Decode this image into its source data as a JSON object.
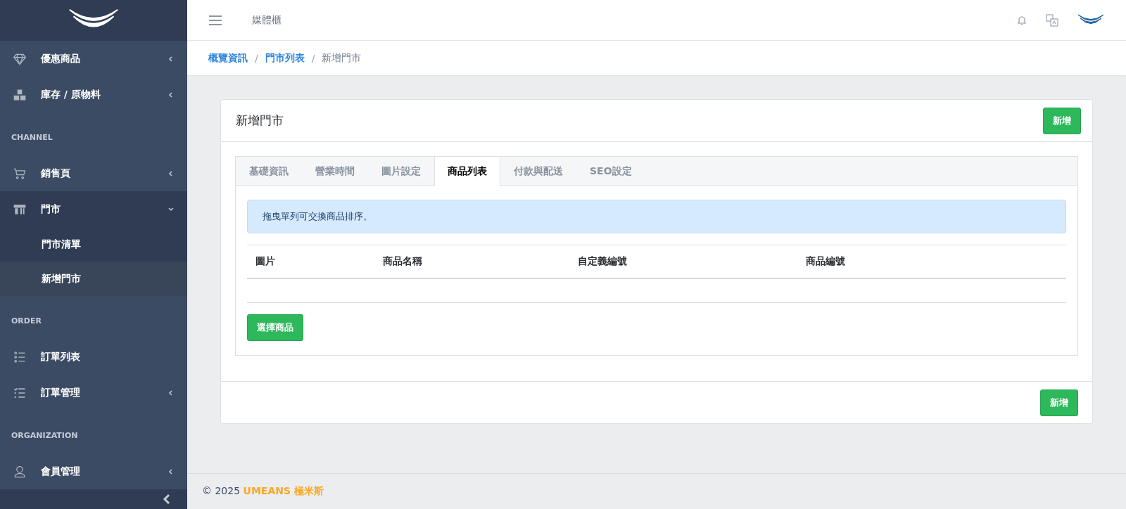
{
  "sidebar": {
    "items": [
      {
        "kind": "item",
        "label": "優惠商品",
        "expanded": false,
        "active": false
      },
      {
        "kind": "item",
        "label": "庫存 / 原物料",
        "expanded": false,
        "active": false
      },
      {
        "kind": "section",
        "label": "CHANNEL"
      },
      {
        "kind": "item",
        "label": "銷售頁",
        "expanded": false,
        "active": false
      },
      {
        "kind": "item",
        "label": "門市",
        "expanded": true,
        "active": true,
        "children": [
          {
            "label": "門市清單",
            "selected": false
          },
          {
            "label": "新增門市",
            "selected": true
          }
        ]
      },
      {
        "kind": "section",
        "label": "ORDER"
      },
      {
        "kind": "item",
        "label": "訂單列表",
        "active": false
      },
      {
        "kind": "item",
        "label": "訂單管理",
        "expanded": false,
        "active": false
      },
      {
        "kind": "section",
        "label": "ORGANIZATION"
      },
      {
        "kind": "item",
        "label": "會員管理",
        "expanded": false,
        "active": false
      }
    ]
  },
  "topbar": {
    "title": "媒體櫃"
  },
  "breadcrumb_separator": "/",
  "breadcrumb": [
    {
      "label": "概覽資訊",
      "link": true
    },
    {
      "label": "門市列表",
      "link": true
    },
    {
      "label": "新增門市",
      "link": false
    }
  ],
  "card": {
    "title": "新增門市",
    "header_button": "新增",
    "footer_button": "新增",
    "tabs": [
      {
        "label": "基礎資訊",
        "selected": false
      },
      {
        "label": "營業時間",
        "selected": false
      },
      {
        "label": "圖片設定",
        "selected": false
      },
      {
        "label": "商品列表",
        "selected": true
      },
      {
        "label": "付款與配送",
        "selected": false
      },
      {
        "label": "SEO設定",
        "selected": false
      }
    ],
    "alert": "拖曳單列可交換商品排序。",
    "table": {
      "columns": [
        "圖片",
        "商品名稱",
        "自定義編號",
        "商品編號"
      ]
    },
    "select_button": "選擇商品"
  },
  "footer": {
    "text": "© 2025 ",
    "brand": "UMEANS 極米斯"
  }
}
